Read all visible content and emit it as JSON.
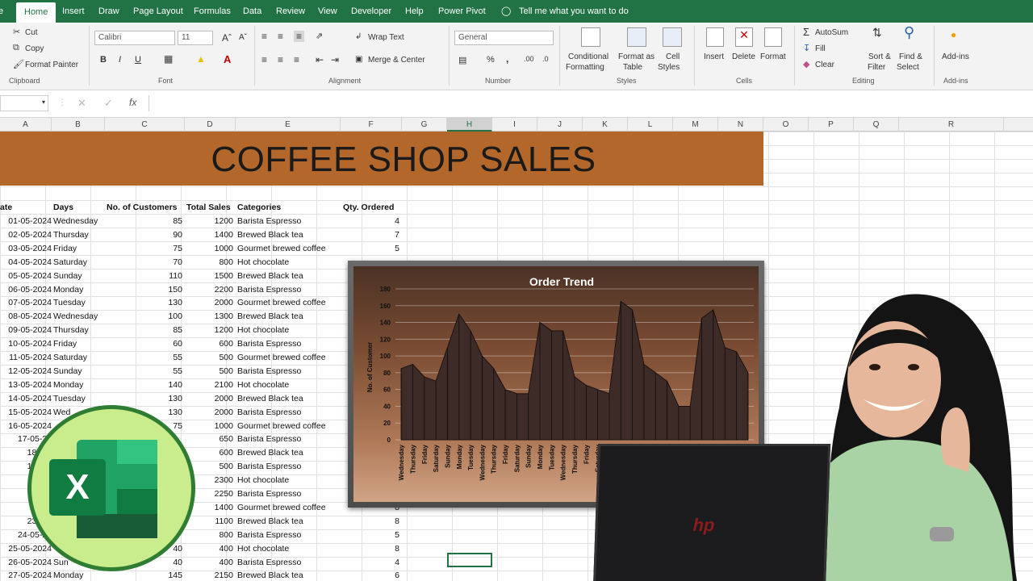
{
  "ribbon_tabs": [
    "e",
    "Home",
    "Insert",
    "Draw",
    "Page Layout",
    "Formulas",
    "Data",
    "Review",
    "View",
    "Developer",
    "Help",
    "Power Pivot"
  ],
  "tell_me": "Tell me what you want to do",
  "clipboard": {
    "cut": "Cut",
    "copy": "Copy",
    "format_painter": "Format Painter",
    "group": "Clipboard"
  },
  "font": {
    "name": "Calibri",
    "size": "11",
    "bold": "B",
    "italic": "I",
    "underline": "U",
    "group": "Font"
  },
  "alignment": {
    "wrap_text": "Wrap Text",
    "merge_center": "Merge & Center",
    "group": "Alignment"
  },
  "number": {
    "format": "General",
    "percent": "%",
    "comma": ",",
    "group": "Number"
  },
  "styles": {
    "conditional_1": "Conditional",
    "conditional_2": "Formatting",
    "format_as_1": "Format as",
    "format_as_2": "Table",
    "cell_1": "Cell",
    "cell_2": "Styles",
    "group": "Styles"
  },
  "cells": {
    "insert": "Insert",
    "delete": "Delete",
    "format": "Format",
    "group": "Cells"
  },
  "editing": {
    "autosum": "AutoSum",
    "fill": "Fill",
    "clear": "Clear",
    "sort_1": "Sort &",
    "sort_2": "Filter",
    "find_1": "Find &",
    "find_2": "Select",
    "group": "Editing"
  },
  "addins": {
    "label": "Add-ins",
    "group": "Add-ins"
  },
  "formula_bar": {
    "fx": "fx",
    "cancel": "✕",
    "enter": "✓"
  },
  "columns": [
    "A",
    "B",
    "C",
    "D",
    "E",
    "F",
    "G",
    "H",
    "I",
    "J",
    "K",
    "L",
    "M",
    "N",
    "O",
    "P",
    "Q",
    "R"
  ],
  "selected_column": "H",
  "banner_title": "COFFEE SHOP SALES",
  "table_headers": {
    "date": "ate",
    "days": "Days",
    "customers": "No. of Customers",
    "sales": "Total Sales",
    "categories": "Categories",
    "qty": "Qty. Ordered"
  },
  "rows": [
    {
      "date": "01-05-2024",
      "day": "Wednesday",
      "customers": "85",
      "sales": "1200",
      "category": "Barista Espresso",
      "qty": "4"
    },
    {
      "date": "02-05-2024",
      "day": "Thursday",
      "customers": "90",
      "sales": "1400",
      "category": "Brewed Black tea",
      "qty": "7"
    },
    {
      "date": "03-05-2024",
      "day": "Friday",
      "customers": "75",
      "sales": "1000",
      "category": "Gourmet brewed coffee",
      "qty": "5"
    },
    {
      "date": "04-05-2024",
      "day": "Saturday",
      "customers": "70",
      "sales": "800",
      "category": "Hot chocolate",
      "qty": ""
    },
    {
      "date": "05-05-2024",
      "day": "Sunday",
      "customers": "110",
      "sales": "1500",
      "category": "Brewed Black tea",
      "qty": ""
    },
    {
      "date": "06-05-2024",
      "day": "Monday",
      "customers": "150",
      "sales": "2200",
      "category": "Barista Espresso",
      "qty": ""
    },
    {
      "date": "07-05-2024",
      "day": "Tuesday",
      "customers": "130",
      "sales": "2000",
      "category": "Gourmet brewed coffee",
      "qty": ""
    },
    {
      "date": "08-05-2024",
      "day": "Wednesday",
      "customers": "100",
      "sales": "1300",
      "category": "Brewed Black tea",
      "qty": ""
    },
    {
      "date": "09-05-2024",
      "day": "Thursday",
      "customers": "85",
      "sales": "1200",
      "category": "Hot chocolate",
      "qty": ""
    },
    {
      "date": "10-05-2024",
      "day": "Friday",
      "customers": "60",
      "sales": "600",
      "category": "Barista Espresso",
      "qty": ""
    },
    {
      "date": "11-05-2024",
      "day": "Saturday",
      "customers": "55",
      "sales": "500",
      "category": "Gourmet brewed coffee",
      "qty": ""
    },
    {
      "date": "12-05-2024",
      "day": "Sunday",
      "customers": "55",
      "sales": "500",
      "category": "Barista Espresso",
      "qty": ""
    },
    {
      "date": "13-05-2024",
      "day": "Monday",
      "customers": "140",
      "sales": "2100",
      "category": "Hot chocolate",
      "qty": ""
    },
    {
      "date": "14-05-2024",
      "day": "Tuesday",
      "customers": "130",
      "sales": "2000",
      "category": "Brewed Black tea",
      "qty": ""
    },
    {
      "date": "15-05-2024",
      "day": "Wed",
      "customers": "130",
      "sales": "2000",
      "category": "Barista Espresso",
      "qty": ""
    },
    {
      "date": "16-05-2024",
      "day": "",
      "customers": "75",
      "sales": "1000",
      "category": "Gourmet brewed coffee",
      "qty": ""
    },
    {
      "date": "17-05-20",
      "day": "",
      "customers": "",
      "sales": "650",
      "category": "Barista Espresso",
      "qty": ""
    },
    {
      "date": "18-05-",
      "day": "",
      "customers": "",
      "sales": "600",
      "category": "Brewed Black tea",
      "qty": ""
    },
    {
      "date": "19-05-",
      "day": "",
      "customers": "",
      "sales": "500",
      "category": "Barista Espresso",
      "qty": ""
    },
    {
      "date": "20-05",
      "day": "",
      "customers": "",
      "sales": "2300",
      "category": "Hot chocolate",
      "qty": ""
    },
    {
      "date": "21-05",
      "day": "",
      "customers": "",
      "sales": "2250",
      "category": "Barista Espresso",
      "qty": ""
    },
    {
      "date": "22-05",
      "day": "",
      "customers": "",
      "sales": "1400",
      "category": "Gourmet brewed coffee",
      "qty": "8"
    },
    {
      "date": "23-05-",
      "day": "",
      "customers": "",
      "sales": "1100",
      "category": "Brewed Black tea",
      "qty": "8"
    },
    {
      "date": "24-05-20",
      "day": "",
      "customers": "",
      "sales": "800",
      "category": "Barista Espresso",
      "qty": "5"
    },
    {
      "date": "25-05-2024",
      "day": "",
      "customers": "40",
      "sales": "400",
      "category": "Hot chocolate",
      "qty": "8"
    },
    {
      "date": "26-05-2024",
      "day": "Sun",
      "customers": "40",
      "sales": "400",
      "category": "Barista Espresso",
      "qty": "4"
    },
    {
      "date": "27-05-2024",
      "day": "Monday",
      "customers": "145",
      "sales": "2150",
      "category": "Brewed Black tea",
      "qty": "6"
    }
  ],
  "excel_logo_letter": "X",
  "laptop_brand": "hp",
  "chart_data": {
    "type": "area",
    "title": "Order Trend",
    "ylabel": "No. of Customer",
    "ylim": [
      0,
      180
    ],
    "yticks": [
      0,
      20,
      40,
      60,
      80,
      100,
      120,
      140,
      160,
      180
    ],
    "categories": [
      "Wednesday",
      "Thursday",
      "Friday",
      "Saturday",
      "Sunday",
      "Monday",
      "Tuesday",
      "Wednesday",
      "Thursday",
      "Friday",
      "Saturday",
      "Sunday",
      "Monday",
      "Tuesday",
      "Wednesday",
      "Thursday",
      "Friday",
      "Saturday",
      "Sunday",
      "Monday",
      "Tuesday",
      "Wednesday",
      "Thursday",
      "Friday",
      "Saturday",
      "Sunday",
      "Monday",
      "Tuesday",
      "Wednesday",
      "Thursday",
      "Friday"
    ],
    "values": [
      85,
      90,
      75,
      70,
      110,
      150,
      130,
      100,
      85,
      60,
      55,
      55,
      140,
      130,
      130,
      75,
      65,
      60,
      55,
      165,
      155,
      90,
      80,
      70,
      40,
      40,
      145,
      155,
      110,
      105,
      80
    ],
    "grid": true,
    "fill_color": "#3d2b27",
    "colors": {
      "banner": "#b4672a",
      "ribbon_green": "#217346"
    }
  }
}
